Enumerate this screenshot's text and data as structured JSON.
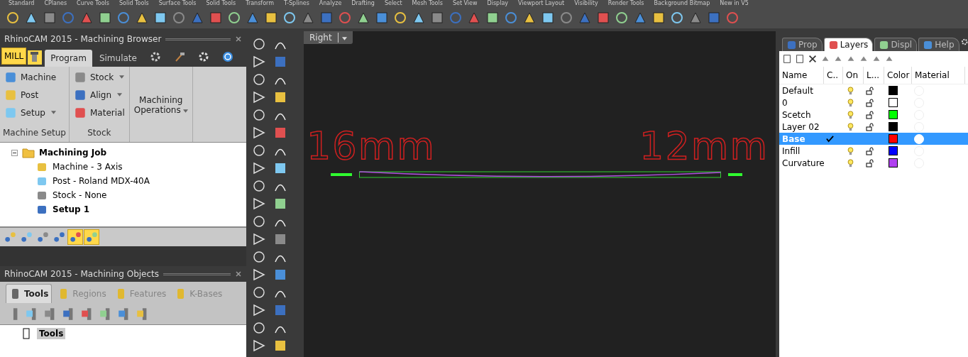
{
  "toolbar_tabs": [
    "Standard",
    "CPlanes",
    "Curve Tools",
    "Solid Tools",
    "Surface Tools",
    "Solid Tools",
    "Transform",
    "T-Splines",
    "Analyze",
    "Drafting",
    "Select",
    "Mesh Tools",
    "Set View",
    "Display",
    "Viewport Layout",
    "Visibility",
    "Render Tools",
    "Background Bitmap",
    "New in V5"
  ],
  "browser": {
    "title": "RhinoCAM 2015 - Machining Browser",
    "tabs": [
      {
        "label": "MILL",
        "selected": false
      },
      {
        "label": "Program",
        "selected": true
      },
      {
        "label": "Simulate",
        "selected": false
      }
    ],
    "groups": [
      {
        "label": "Machine Setup",
        "items": [
          {
            "label": "Machine",
            "dropdown": false
          },
          {
            "label": "Post",
            "dropdown": false
          },
          {
            "label": "Setup",
            "dropdown": true
          }
        ]
      },
      {
        "label": "Stock",
        "items": [
          {
            "label": "Stock",
            "dropdown": true
          },
          {
            "label": "Align",
            "dropdown": true
          },
          {
            "label": "Material",
            "dropdown": false
          }
        ]
      }
    ],
    "operations": {
      "label": "Machining Operations",
      "dropdown": true
    },
    "tree": {
      "label": "Machining Job",
      "bold": true,
      "expanded": true,
      "children": [
        {
          "label": "Machine - 3 Axis",
          "bold": false
        },
        {
          "label": "Post - Roland MDX-40A",
          "bold": false
        },
        {
          "label": "Stock - None",
          "bold": false
        },
        {
          "label": "Setup 1",
          "bold": true
        }
      ]
    }
  },
  "objects": {
    "title": "RhinoCAM 2015 - Machining Objects",
    "tabs": [
      {
        "label": "Tools",
        "selected": true,
        "disabled": false
      },
      {
        "label": "Regions",
        "selected": false,
        "disabled": true
      },
      {
        "label": "Features",
        "selected": false,
        "disabled": true
      },
      {
        "label": "K-Bases",
        "selected": false,
        "disabled": true
      }
    ],
    "tree": [
      {
        "label": "Tools",
        "selected": true
      }
    ]
  },
  "viewport": {
    "view": "Right",
    "left_text": "16mm",
    "right_text": "12mm"
  },
  "layers": {
    "tabs": [
      {
        "label": "Prop",
        "selected": false
      },
      {
        "label": "Layers",
        "selected": true
      },
      {
        "label": "Displ",
        "selected": false
      },
      {
        "label": "Help",
        "selected": false
      }
    ],
    "columns": [
      "Name",
      "C..",
      "On",
      "L...",
      "Color",
      "Material"
    ],
    "rows": [
      {
        "name": "Default",
        "current": false,
        "selected": false,
        "color": "#000000"
      },
      {
        "name": "0",
        "current": false,
        "selected": false,
        "color": "#ffffff"
      },
      {
        "name": "Scetch",
        "current": false,
        "selected": false,
        "color": "#00ff00"
      },
      {
        "name": "Layer 02",
        "current": false,
        "selected": false,
        "color": "#000000"
      },
      {
        "name": "Base",
        "current": true,
        "selected": true,
        "color": "#ff0000"
      },
      {
        "name": "Infill",
        "current": false,
        "selected": false,
        "color": "#0000ff"
      },
      {
        "name": "Curvature",
        "current": false,
        "selected": false,
        "color": "#b040f0"
      }
    ]
  }
}
